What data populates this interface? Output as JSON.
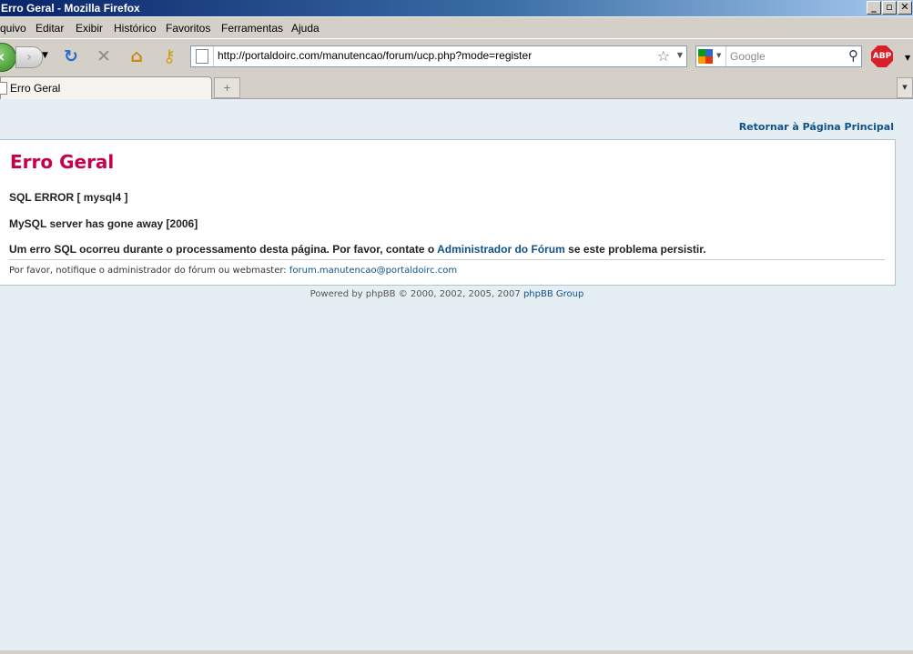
{
  "window": {
    "title": "Erro Geral - Mozilla Firefox"
  },
  "menu": [
    "quivo",
    "Editar",
    "Exibir",
    "Histórico",
    "Favoritos",
    "Ferramentas",
    "Ajuda"
  ],
  "toolbar": {
    "url": "http://portaldoirc.com/manutencao/forum/ucp.php?mode=register",
    "search_placeholder": "Google",
    "abp_label": "ABP"
  },
  "tabs": [
    {
      "label": "Erro Geral"
    }
  ],
  "page": {
    "return_link": "Retornar à Página Principal",
    "title": "Erro Geral",
    "sql_error": "SQL ERROR [ mysql4 ]",
    "mysql_message": "MySQL server has gone away [2006]",
    "message_prefix": "Um erro SQL ocorreu durante o processamento desta página. Por favor, contate o",
    "admin_link": "Administrador do Fórum",
    "message_suffix": "se este problema persistir.",
    "notify_prefix": "Por favor, notifique o administrador do fórum ou webmaster:",
    "notify_email": "forum.manutencao@portaldoirc.com",
    "footer_prefix": "Powered by phpBB © 2000, 2002, 2005, 2007",
    "footer_link": "phpBB Group"
  },
  "colors": {
    "title_red": "#c6004a",
    "link_blue": "#105289",
    "page_bg": "#e5eef3"
  },
  "icons": {
    "back": "back-arrow-icon",
    "forward": "forward-arrow-icon",
    "reload": "reload-icon",
    "stop": "stop-icon",
    "home": "home-icon",
    "key": "key-icon",
    "bookmark": "star-icon",
    "search": "magnifier-icon"
  }
}
